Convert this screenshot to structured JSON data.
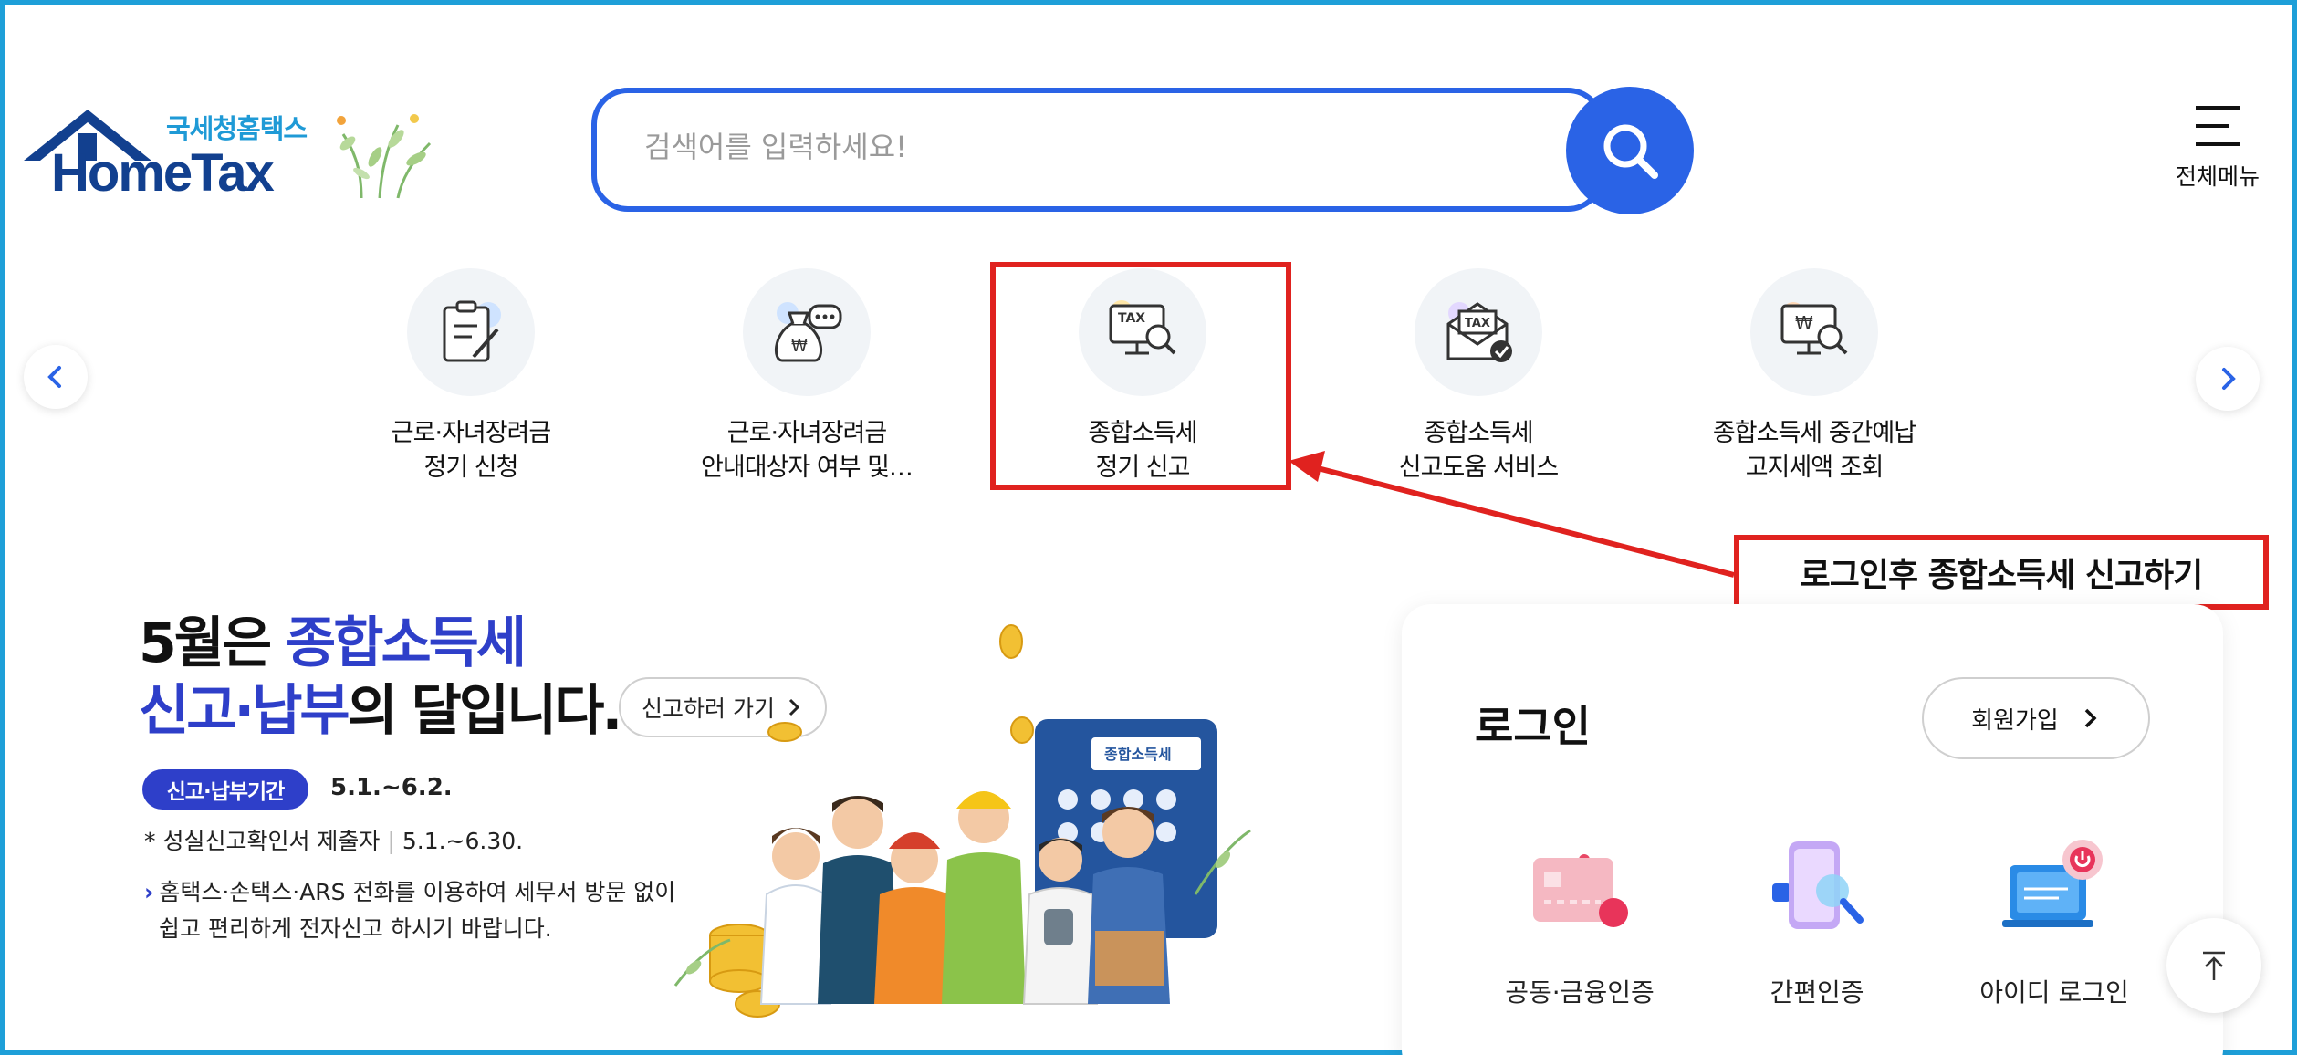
{
  "header": {
    "logo_sub": "국세청홈택스",
    "logo_main": "HomeTax",
    "search_placeholder": "검색어를 입력하세요!",
    "all_menu_label": "전체메뉴"
  },
  "quick_menu": {
    "items": [
      {
        "line1": "근로·자녀장려금",
        "line2": "정기 신청",
        "icon": "clipboard-pen-icon"
      },
      {
        "line1": "근로·자녀장려금",
        "line2": "안내대상자 여부 및…",
        "icon": "money-bag-chat-icon"
      },
      {
        "line1": "종합소득세",
        "line2": "정기 신고",
        "icon": "tax-monitor-search-icon"
      },
      {
        "line1": "종합소득세",
        "line2": "신고도움 서비스",
        "icon": "tax-envelope-check-icon"
      },
      {
        "line1": "종합소득세 중간예납",
        "line2": "고지세액 조회",
        "icon": "won-monitor-search-icon"
      }
    ]
  },
  "callout": {
    "text": "로그인후 종합소득세 신고하기"
  },
  "banner": {
    "line1_prefix": "5월은 ",
    "line1_highlight": "종합소득세",
    "line2_highlight": "신고·납부",
    "line2_suffix": "의 달입니다.",
    "go_button": "신고하러 가기",
    "period_badge": "신고·납부기간",
    "period_date": "5.1.~6.2.",
    "sincere_label": "* 성실신고확인서 제출자",
    "sincere_date": "5.1.~6.30.",
    "note_line1": "홈택스·손택스·ARS 전화를 이용하여 세무서 방문 없이",
    "note_line2": "쉽고 편리하게 전자신고 하시기 바랍니다.",
    "calculator_label": "종합소득세"
  },
  "login": {
    "title": "로그인",
    "signup_button": "회원가입",
    "options": [
      {
        "label": "공동·금융인증",
        "icon": "certificate-card-icon"
      },
      {
        "label": "간편인증",
        "icon": "phone-search-icon"
      },
      {
        "label": "아이디 로그인",
        "icon": "laptop-power-icon"
      }
    ]
  },
  "colors": {
    "brand_blue": "#2a63e6",
    "logo_navy": "#12408f",
    "highlight_red": "#e0221f",
    "banner_blue": "#2e3fc9"
  }
}
